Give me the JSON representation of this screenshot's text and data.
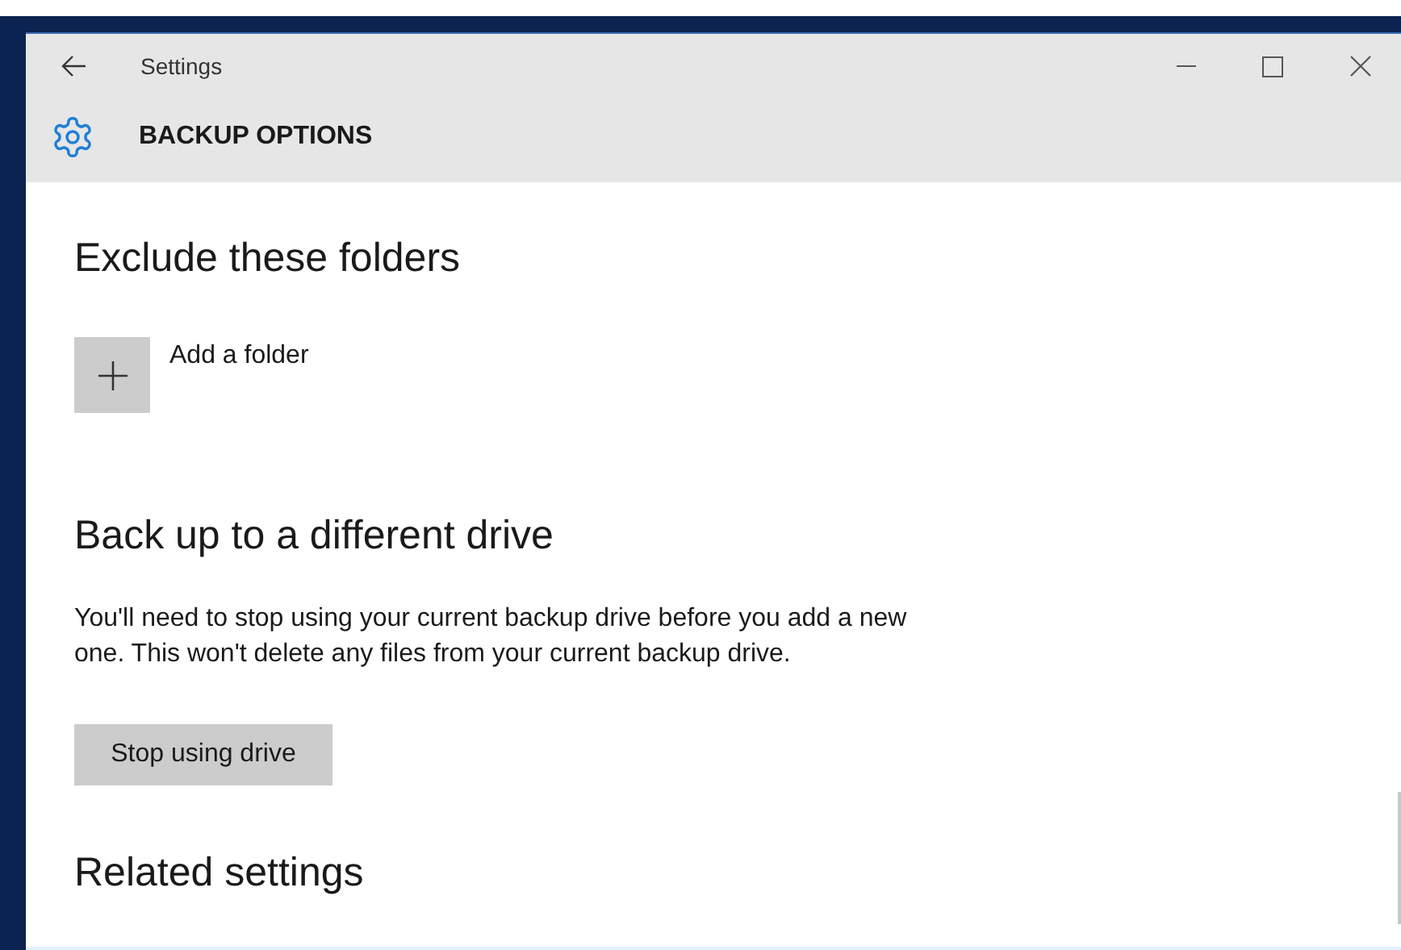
{
  "window": {
    "title": "Settings"
  },
  "header": {
    "title": "BACKUP OPTIONS"
  },
  "sections": [
    {
      "kind": "folders",
      "heading": "Exclude these folders",
      "add_label": "Add a folder"
    },
    {
      "kind": "drive",
      "heading": "Back up to a different drive",
      "text": "You'll need to stop using your current backup drive before you add a new one. This won't delete any files from your current backup drive.",
      "button": "Stop using drive"
    },
    {
      "kind": "heading",
      "heading": "Related settings"
    }
  ]
}
